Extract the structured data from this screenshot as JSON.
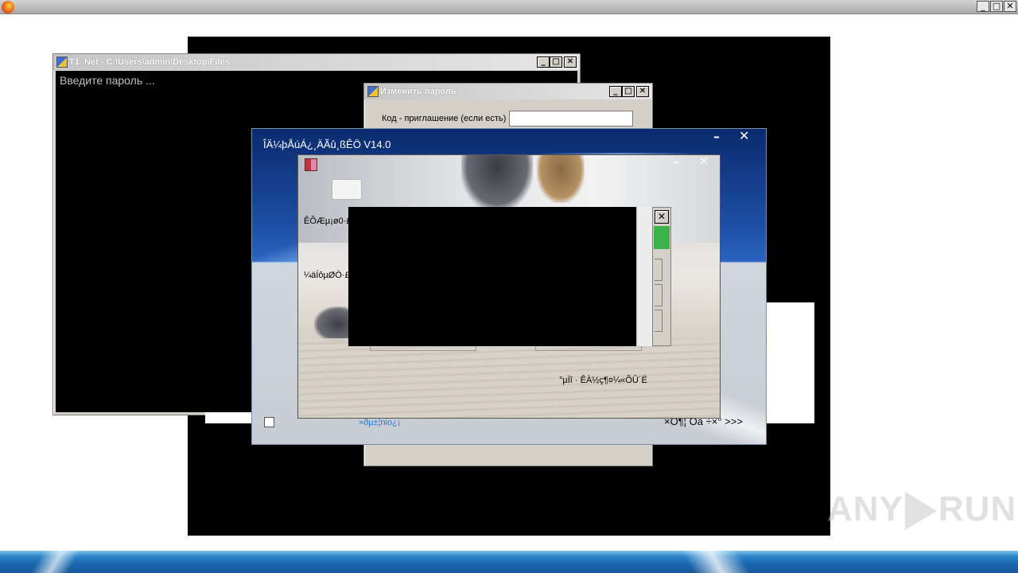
{
  "browser": {
    "min_icon": "minimize-icon",
    "max_icon": "maximize-icon",
    "close_icon": "close-icon"
  },
  "console_window": {
    "title": "T1_Net - C:\\Users\\admin\\Desktop\\Files",
    "prompt": "Введите пароль ..."
  },
  "password_window": {
    "title": "Изменить пароль",
    "invite_label": "Код - приглашение (если есть)",
    "invite_value": ""
  },
  "main_window": {
    "title": "ÎÄ¼þÅúÁ¿¸ÄÃû¸ßÊÖ V14.0",
    "min_label": "–",
    "close_label": "✕",
    "link_text": "»ðµ±¦nio¿¡",
    "next_text": "×Ó¶¦ Óà ÷×° >>>"
  },
  "photo_window": {
    "label1": "ÊÕÆµ¡ø0·£",
    "label2": "¼äÍôµØÖ·£",
    "label3": "°µÏî · ÊÀ½ç¶¤¼«ÕÛ´Ë",
    "min_label": "–",
    "close_label": "✕"
  },
  "sidebar": {
    "close_label": "✕"
  },
  "watermark": {
    "left": "ANY",
    "right": "RUN"
  },
  "colors": {
    "accent_green": "#3cb34a",
    "taskbar_blue": "#1a66ad",
    "link_blue": "#2b7bd6"
  }
}
